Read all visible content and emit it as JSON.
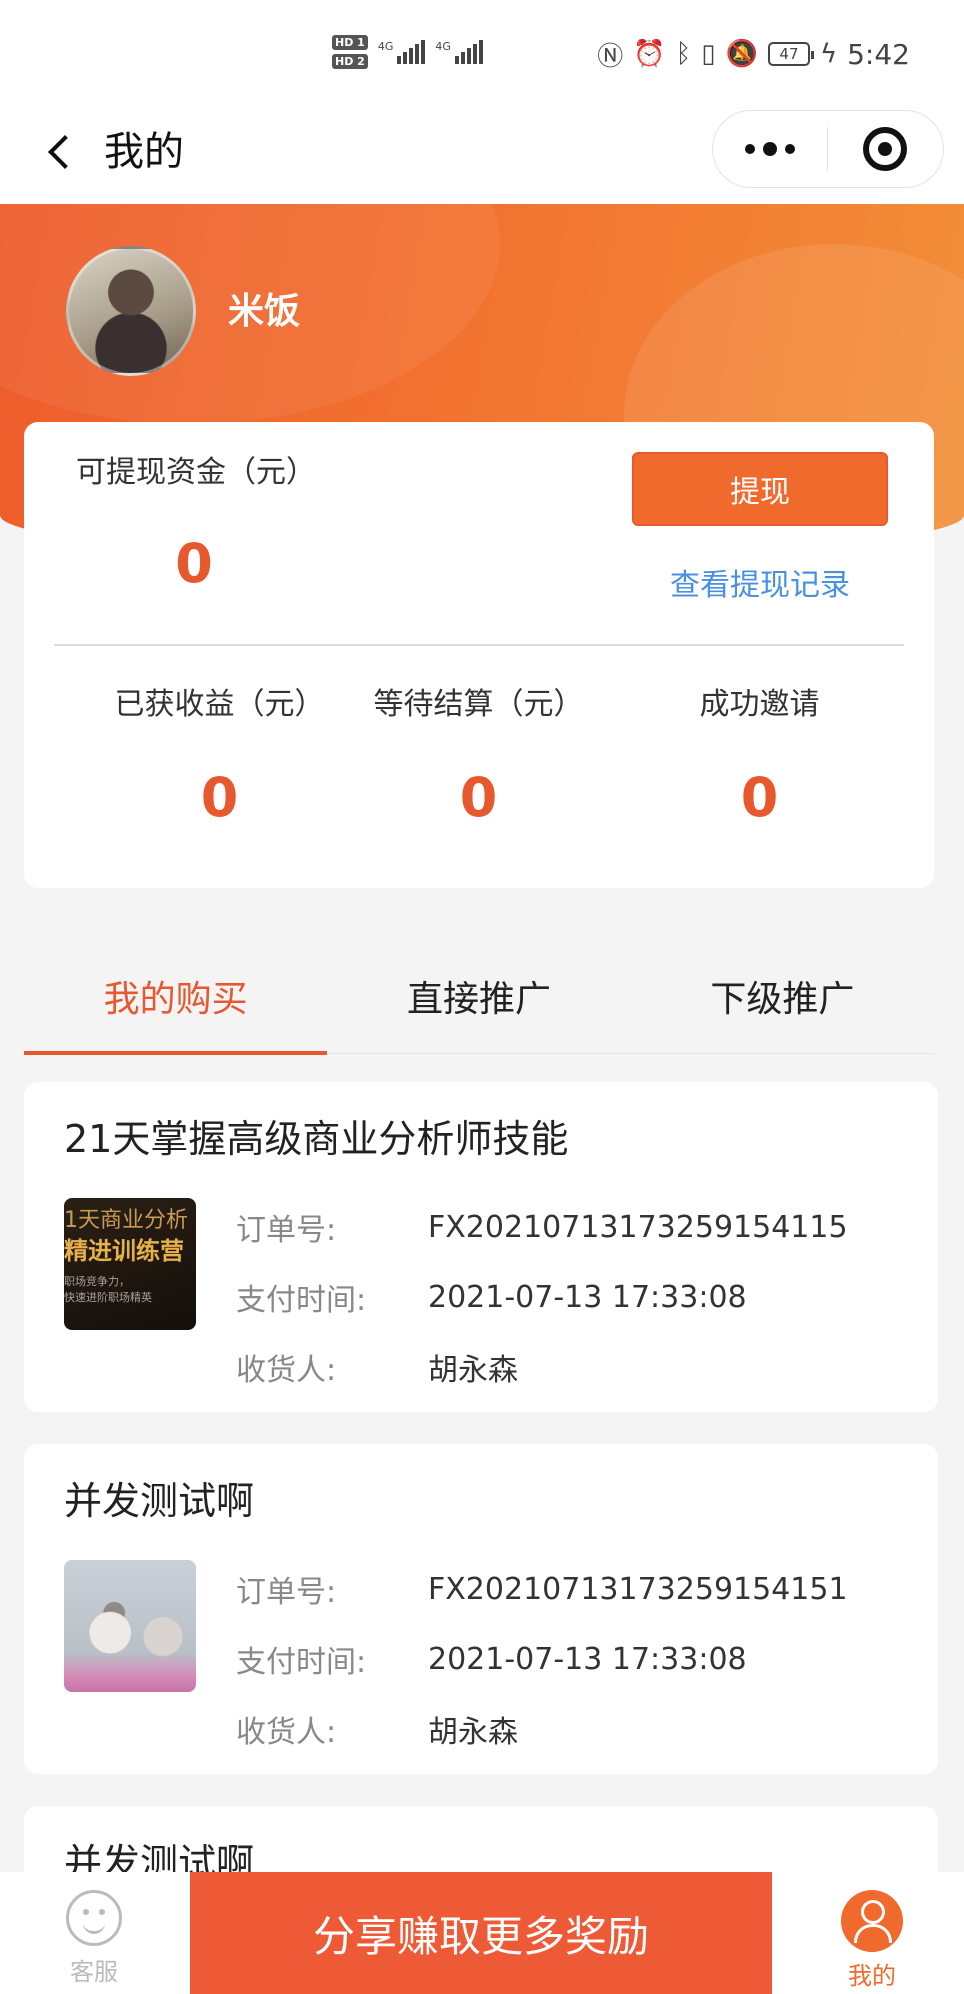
{
  "status_bar": {
    "hd1": "HD 1",
    "hd2": "HD 2",
    "net1": "4G",
    "net2": "4G",
    "battery": "47",
    "time": "5:42"
  },
  "nav": {
    "title": "我的"
  },
  "profile": {
    "name": "米饭"
  },
  "wallet": {
    "withdrawable_label": "可提现资金（元）",
    "withdrawable_value": "0",
    "withdraw_button": "提现",
    "withdraw_record_link": "查看提现记录",
    "stats": [
      {
        "label": "已获收益（元）",
        "value": "0"
      },
      {
        "label": "等待结算（元）",
        "value": "0"
      },
      {
        "label": "成功邀请",
        "value": "0"
      }
    ]
  },
  "tabs": [
    {
      "label": "我的购买",
      "active": true
    },
    {
      "label": "直接推广",
      "active": false
    },
    {
      "label": "下级推广",
      "active": false
    }
  ],
  "order_field_labels": {
    "order_no": "订单号:",
    "pay_time": "支付时间:",
    "receiver": "收货人:"
  },
  "orders": [
    {
      "title": "21天掌握高级商业分析师技能",
      "thumb_text": [
        "1天商业分析",
        "精进训练营",
        "职场竞争力，",
        "快速进阶职场精英"
      ],
      "order_no": "FX20210713173259154115",
      "pay_time": "2021-07-13 17:33:08",
      "receiver": "胡永森"
    },
    {
      "title": "并发测试啊",
      "order_no": "FX20210713173259154151",
      "pay_time": "2021-07-13 17:33:08",
      "receiver": "胡永森"
    },
    {
      "title": "并发测试啊"
    }
  ],
  "bottom_bar": {
    "service_label": "客服",
    "share_button": "分享赚取更多奖励",
    "mine_label": "我的"
  },
  "colors": {
    "accent": "#e8582f",
    "link": "#4a90e2",
    "share": "#ef5a36"
  }
}
